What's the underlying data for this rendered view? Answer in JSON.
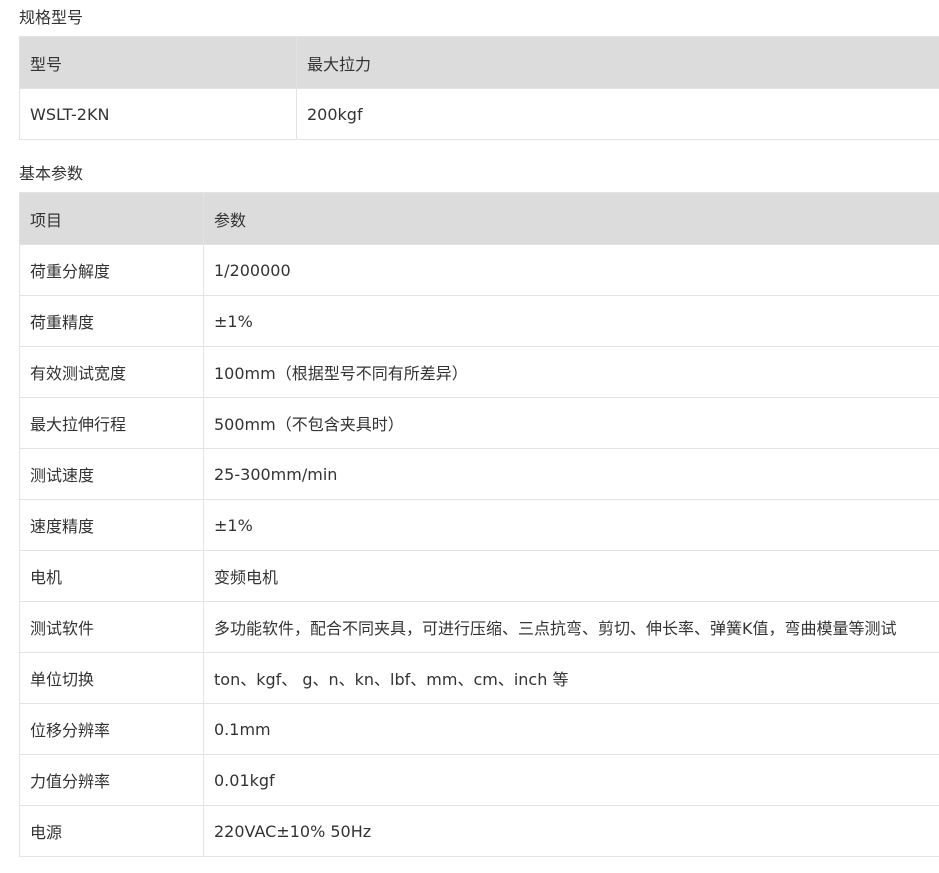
{
  "spec_section": {
    "title": "规格型号",
    "headers": [
      "型号",
      "最大拉力"
    ],
    "rows": [
      [
        "WSLT-2KN",
        "200kgf"
      ]
    ]
  },
  "params_section": {
    "title": "基本参数",
    "headers": [
      "项目",
      "参数"
    ],
    "rows": [
      [
        "荷重分解度",
        "1/200000"
      ],
      [
        "荷重精度",
        "±1%"
      ],
      [
        "有效测试宽度",
        "100mm（根据型号不同有所差异）"
      ],
      [
        "最大拉伸行程",
        "500mm（不包含夹具时）"
      ],
      [
        "测试速度",
        "25-300mm/min"
      ],
      [
        "速度精度",
        "±1%"
      ],
      [
        "电机",
        "变频电机"
      ],
      [
        "测试软件",
        "多功能软件，配合不同夹具，可进行压缩、三点抗弯、剪切、伸长率、弹簧K值，弯曲模量等测试"
      ],
      [
        "单位切换",
        "ton、kgf、 g、n、kn、lbf、mm、cm、inch 等"
      ],
      [
        "位移分辨率",
        "0.1mm"
      ],
      [
        "力值分辨率",
        "0.01kgf"
      ],
      [
        "电源",
        "220VAC±10% 50Hz"
      ]
    ]
  }
}
